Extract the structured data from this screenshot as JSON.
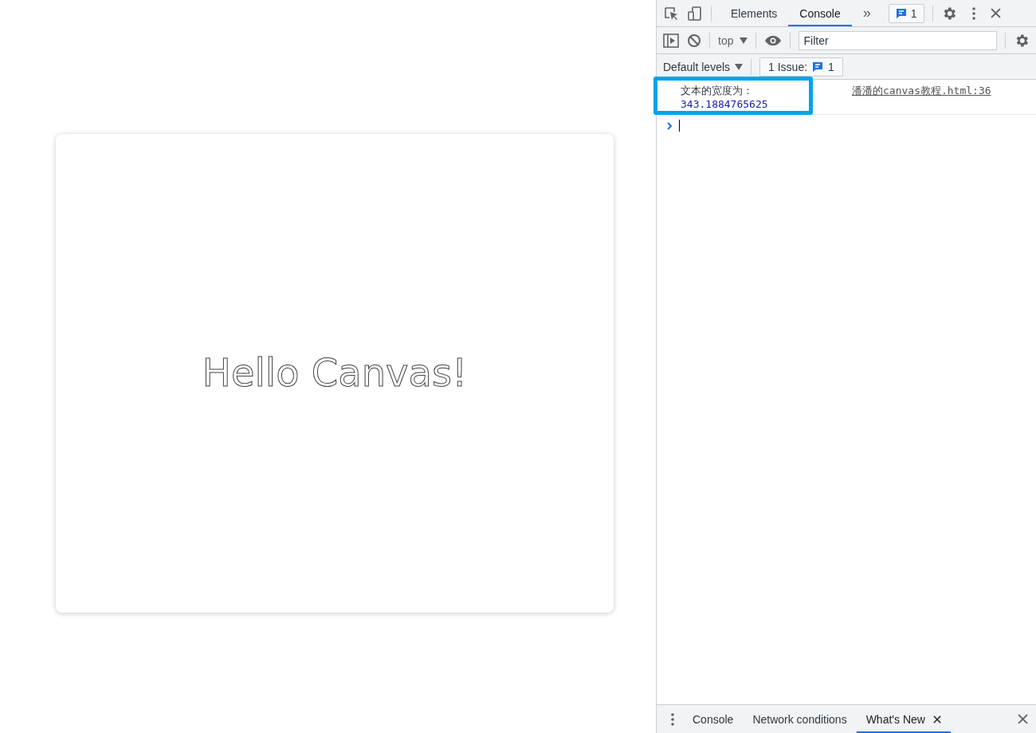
{
  "canvas": {
    "text": "Hello Canvas!"
  },
  "devtools": {
    "tabs": [
      {
        "label": "Elements",
        "selected": false
      },
      {
        "label": "Console",
        "selected": true
      }
    ],
    "more": "»",
    "message_count": "1",
    "toolbar": {
      "context": "top",
      "filter": {
        "placeholder": "Filter"
      }
    },
    "levels": "Default levels",
    "issues": {
      "label": "1 Issue:",
      "count": "1"
    },
    "console": {
      "messages": [
        {
          "text": "文本的宽度为：",
          "value": "343.1884765625",
          "source": "潘潘的canvas教程.html:36",
          "highlighted": true
        }
      ]
    },
    "drawer": {
      "tabs": [
        {
          "label": "Console",
          "selected": false,
          "closable": false
        },
        {
          "label": "Network conditions",
          "selected": false,
          "closable": false
        },
        {
          "label": "What's New",
          "selected": true,
          "closable": true
        }
      ]
    }
  }
}
